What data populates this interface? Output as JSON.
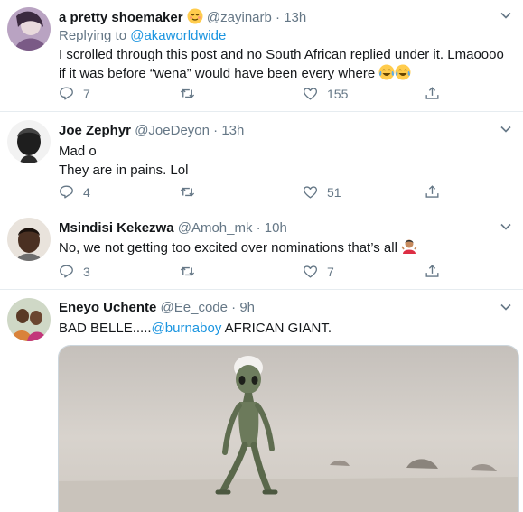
{
  "tweets": [
    {
      "name": "a pretty shoemaker",
      "handle": "@zayinarb",
      "time": "· 13h",
      "replying_prefix": "Replying to ",
      "replying_to": "@akaworldwide",
      "text": "I scrolled through this post and no South African replied under it.  Lmaoooo if it was before “wena” would have been every where",
      "replies": "7",
      "retweets": "",
      "likes": "155",
      "name_emoji": "relieved-face-emoji",
      "text_emoji": "tears-of-joy-emoji"
    },
    {
      "name": "Joe Zephyr",
      "handle": "@JoeDeyon",
      "time": "· 13h",
      "text_line1": "Mad o",
      "text_line2": "They are in pains. Lol",
      "replies": "4",
      "retweets": "",
      "likes": "51"
    },
    {
      "name": "Msindisi Kekezwa",
      "handle": "@Amoh_mk",
      "time": "· 10h",
      "text": "No, we not getting too excited over nominations that’s all",
      "replies": "3",
      "retweets": "",
      "likes": "7",
      "text_emoji": "person-shrugging-emoji"
    },
    {
      "name": "Eneyo Uchente",
      "handle": "@Ee_code",
      "time": "· 9h",
      "text_before": "BAD BELLE.....",
      "mention": "@burnaboy",
      "text_after": " AFRICAN GIANT.",
      "media": "dancing-alien-video-thumbnail"
    }
  ],
  "colors": {
    "text": "#14171a",
    "secondary": "#657786",
    "link": "#1b95e0",
    "divider": "#e6ecf0"
  }
}
